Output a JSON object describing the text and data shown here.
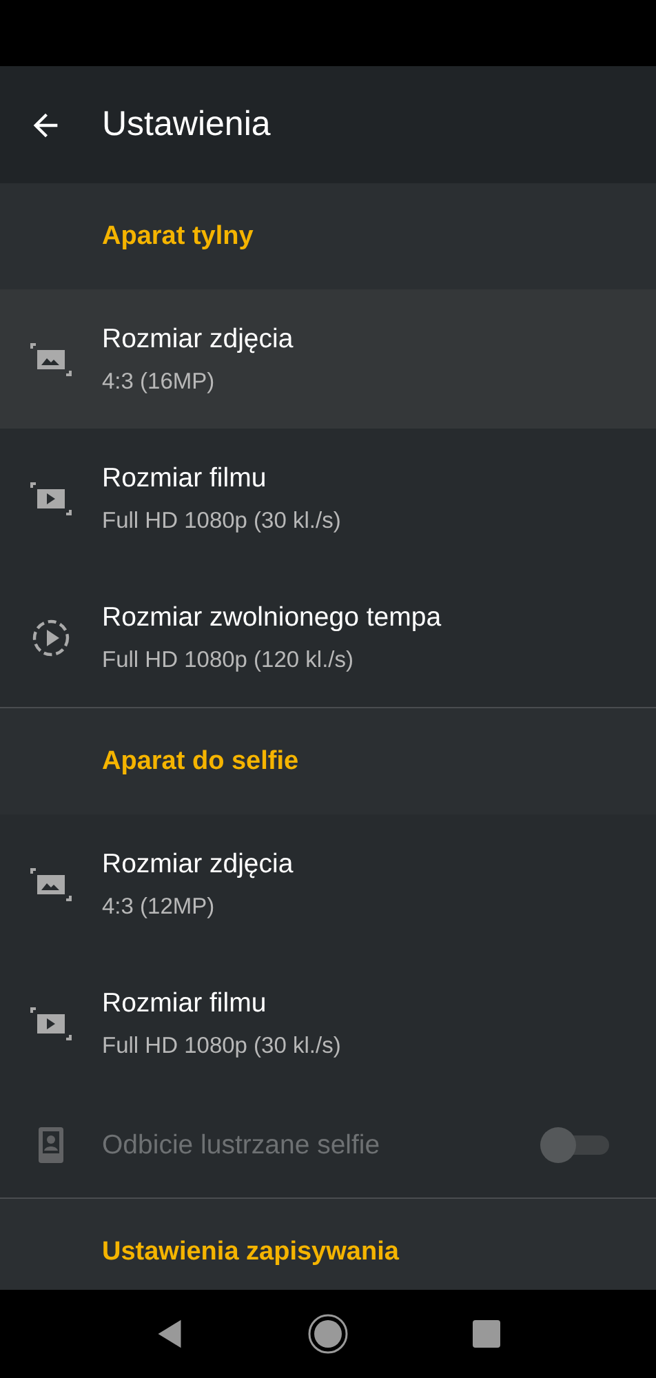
{
  "app_bar": {
    "title": "Ustawienia"
  },
  "sections": [
    {
      "title": "Aparat tylny",
      "items": [
        {
          "kind": "photo",
          "title": "Rozmiar zdjęcia",
          "value": "4:3 (16MP)",
          "selected": true,
          "disabled": false
        },
        {
          "kind": "video",
          "title": "Rozmiar filmu",
          "value": "Full HD 1080p (30 kl./s)",
          "selected": false,
          "disabled": false
        },
        {
          "kind": "slowmo",
          "title": "Rozmiar zwolnionego tempa",
          "value": "Full HD 1080p (120 kl./s)",
          "selected": false,
          "disabled": false
        }
      ]
    },
    {
      "title": "Aparat do selfie",
      "items": [
        {
          "kind": "photo",
          "title": "Rozmiar zdjęcia",
          "value": "4:3 (12MP)",
          "selected": false,
          "disabled": false
        },
        {
          "kind": "video",
          "title": "Rozmiar filmu",
          "value": "Full HD 1080p (30 kl./s)",
          "selected": false,
          "disabled": false
        },
        {
          "kind": "mirror",
          "title": "Odbicie lustrzane selfie",
          "on": false,
          "selected": false,
          "disabled": true
        }
      ]
    },
    {
      "title": "Ustawienia zapisywania"
    }
  ]
}
